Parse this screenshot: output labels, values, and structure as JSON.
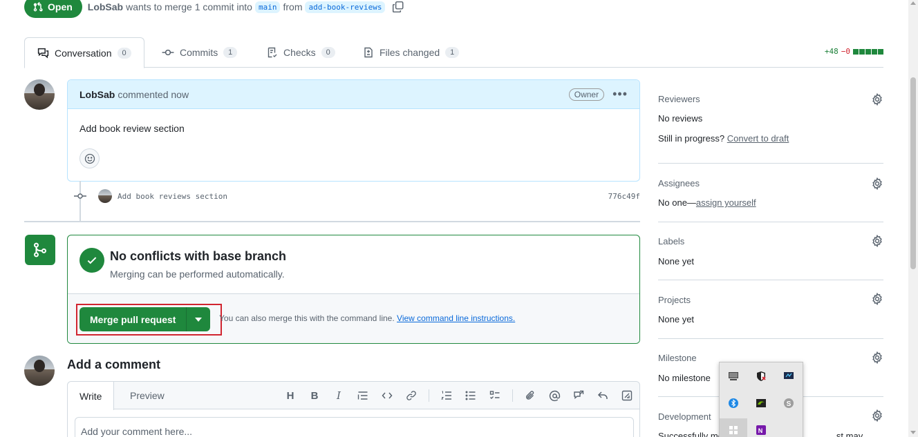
{
  "pr": {
    "state": "Open",
    "author": "LobSab",
    "action_text": "wants to merge 1 commit into",
    "base_branch": "main",
    "from_text": "from",
    "head_branch": "add-book-reviews"
  },
  "tabs": [
    {
      "label": "Conversation",
      "count": "0"
    },
    {
      "label": "Commits",
      "count": "1"
    },
    {
      "label": "Checks",
      "count": "0"
    },
    {
      "label": "Files changed",
      "count": "1"
    }
  ],
  "diffstat": {
    "additions": "+48",
    "deletions": "−0"
  },
  "comment": {
    "author": "LobSab",
    "meta": "commented now",
    "role": "Owner",
    "body": "Add book review section"
  },
  "commit": {
    "message": "Add book reviews section",
    "sha": "776c49f"
  },
  "merge": {
    "title": "No conflicts with base branch",
    "subtitle": "Merging can be performed automatically.",
    "button_label": "Merge pull request",
    "hint": "You can also merge this with the command line.",
    "hint_link": "View command line instructions."
  },
  "add_comment": {
    "title": "Add a comment",
    "tab_write": "Write",
    "tab_preview": "Preview",
    "placeholder": "Add your comment here..."
  },
  "sidebar": {
    "reviewers": {
      "label": "Reviewers",
      "value": "No reviews",
      "progress_q": "Still in progress?",
      "progress_link": "Convert to draft"
    },
    "assignees": {
      "label": "Assignees",
      "value": "No one—",
      "link": "assign yourself"
    },
    "labels": {
      "label": "Labels",
      "value": "None yet"
    },
    "projects": {
      "label": "Projects",
      "value": "None yet"
    },
    "milestone": {
      "label": "Milestone",
      "value": "No milestone"
    },
    "development": {
      "label": "Development",
      "value": "Successfully me",
      "value_tail": "st may close these"
    }
  },
  "colors": {
    "green": "#1f883d",
    "blue_link": "#0969da",
    "comment_header_bg": "#ddf4ff",
    "highlight_red": "#d1242f"
  }
}
